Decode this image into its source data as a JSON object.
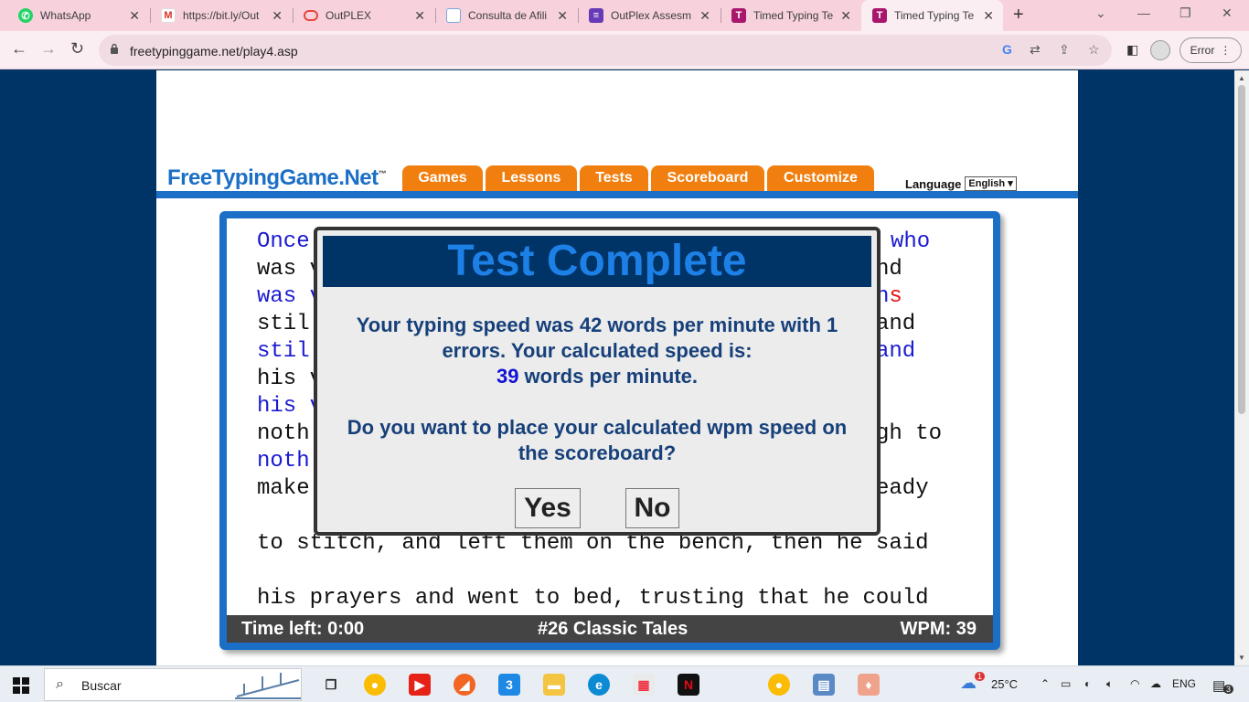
{
  "browser": {
    "tabs": [
      {
        "title": "WhatsApp",
        "icon": "whatsapp-icon",
        "color": "#25d366"
      },
      {
        "title": "https://bit.ly/Out",
        "icon": "gmail-icon",
        "color": "#d93025"
      },
      {
        "title": "OutPLEX",
        "icon": "outplex-icon",
        "color": "#e8453c"
      },
      {
        "title": "Consulta de Afili",
        "icon": "document-icon",
        "color": "#7aa7d9"
      },
      {
        "title": "OutPlex Assesm",
        "icon": "forms-icon",
        "color": "#673ab7"
      },
      {
        "title": "Timed Typing Te",
        "icon": "typing-icon",
        "color": "#a8176b"
      },
      {
        "title": "Timed Typing Te",
        "icon": "typing-icon",
        "color": "#a8176b"
      }
    ],
    "url": "freetypinggame.net/play4.asp",
    "error_label": "Error"
  },
  "site": {
    "logo": "FreeTypingGame.Net",
    "logo_tm": "™",
    "nav": [
      "Games",
      "Lessons",
      "Tests",
      "Scoreboard",
      "Customize"
    ],
    "language_label": "Language",
    "language_value": "English"
  },
  "passage": {
    "lines": [
      {
        "text": "Once",
        "right": "who",
        "style": "typed"
      },
      {
        "text": "was v",
        "right": "nd",
        "style": "plain"
      },
      {
        "text": "was v",
        "right": "ns",
        "style": "typed"
      },
      {
        "text": "stil",
        "right": "and",
        "style": "plain"
      },
      {
        "text": "stil",
        "right": "and",
        "style": "typed"
      },
      {
        "text": "his v",
        "right": "",
        "style": "plain"
      },
      {
        "text": "his v",
        "right": "",
        "style": "typed"
      },
      {
        "text": "noth",
        "right": "gh to",
        "style": "plain"
      },
      {
        "text": "noth",
        "right": "",
        "style": "typed"
      },
      {
        "text": "make",
        "right": "eady",
        "style": "plain"
      },
      {
        "text": "to stitch, and left them on the bench, then he said",
        "right": "",
        "style": "plain"
      },
      {
        "text": "his prayers and went to bed, trusting that he could",
        "right": "",
        "style": "plain"
      }
    ],
    "error_char": "s"
  },
  "status": {
    "time_left": "Time left: 0:00",
    "test_name": "#26 Classic Tales",
    "wpm": "WPM: 39"
  },
  "dialog": {
    "title": "Test Complete",
    "line1": "Your typing speed was 42 words per minute with 1",
    "line2": "errors. Your calculated speed is:",
    "calc_value": "39",
    "calc_suffix": " words per minute.",
    "question1": "Do you want to place your calculated wpm speed on",
    "question2": "the scoreboard?",
    "yes_label": "Yes",
    "no_label": "No"
  },
  "taskbar": {
    "search_placeholder": "Buscar",
    "temperature": "25°C",
    "language": "ENG",
    "notification_count": "3",
    "weather_badge": "1"
  }
}
